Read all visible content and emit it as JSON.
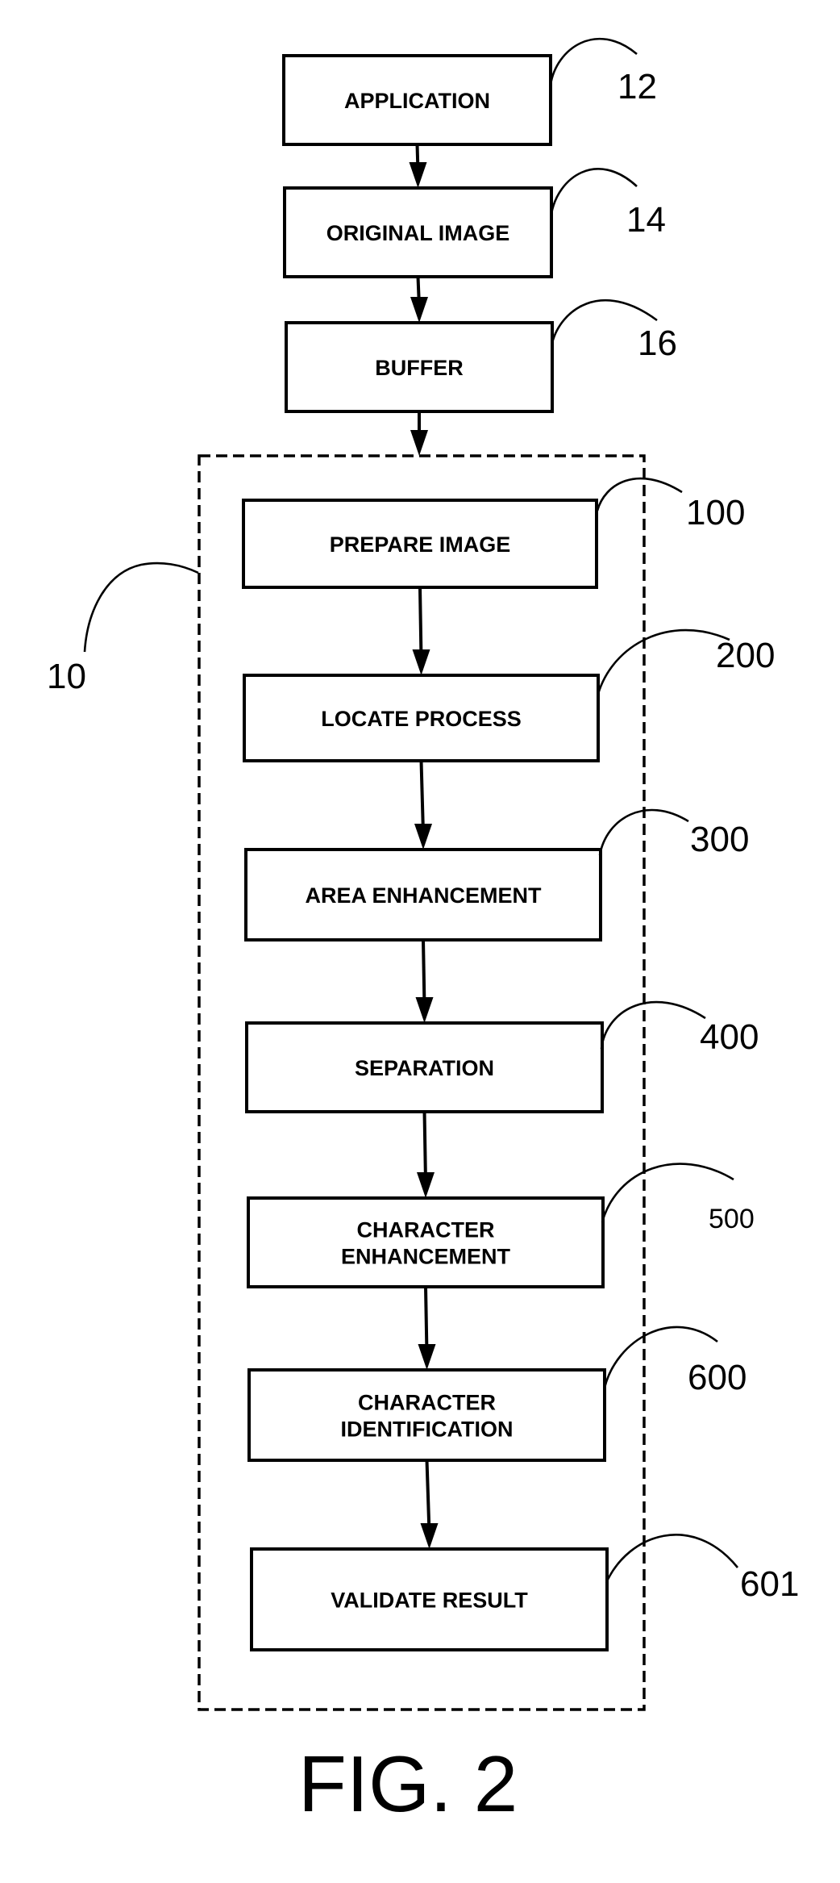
{
  "figure": {
    "caption": "FIG. 2",
    "system_ref": "10"
  },
  "boxes": [
    {
      "id": "application",
      "lines": [
        "APPLICATION"
      ],
      "ref": "12"
    },
    {
      "id": "original-image",
      "lines": [
        "ORIGINAL IMAGE"
      ],
      "ref": "14"
    },
    {
      "id": "buffer",
      "lines": [
        "BUFFER"
      ],
      "ref": "16"
    },
    {
      "id": "prepare-image",
      "lines": [
        "PREPARE IMAGE"
      ],
      "ref": "100"
    },
    {
      "id": "locate-process",
      "lines": [
        "LOCATE PROCESS"
      ],
      "ref": "200"
    },
    {
      "id": "area-enhancement",
      "lines": [
        "AREA ENHANCEMENT"
      ],
      "ref": "300"
    },
    {
      "id": "separation",
      "lines": [
        "SEPARATION"
      ],
      "ref": "400"
    },
    {
      "id": "character-enhancement",
      "lines": [
        "CHARACTER",
        "ENHANCEMENT"
      ],
      "ref": "500"
    },
    {
      "id": "character-identification",
      "lines": [
        "CHARACTER",
        "IDENTIFICATION"
      ],
      "ref": "600"
    },
    {
      "id": "validate-result",
      "lines": [
        "VALIDATE RESULT"
      ],
      "ref": "601"
    }
  ]
}
